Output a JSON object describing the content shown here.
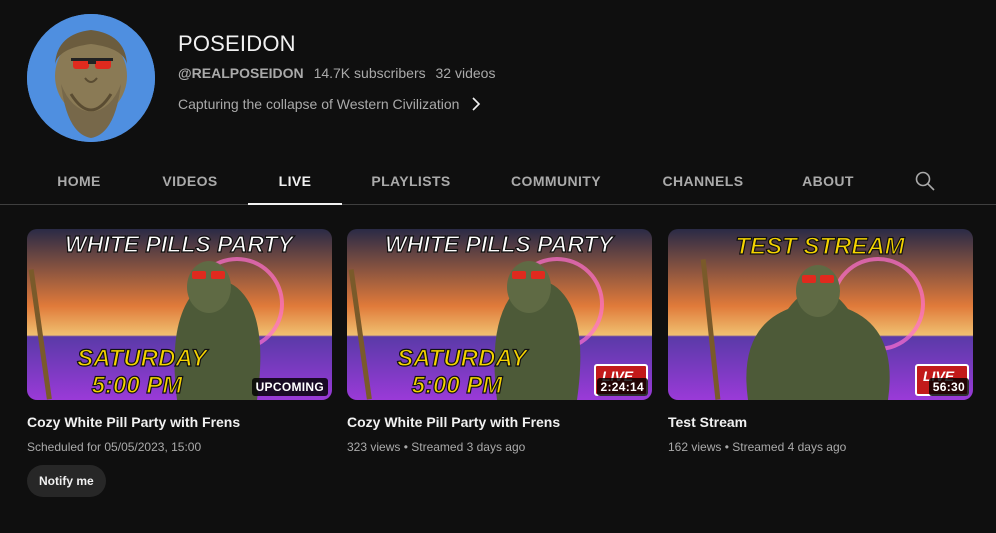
{
  "channel": {
    "name": "POSEIDON",
    "handle": "@REALPOSEIDON",
    "subscribers": "14.7K subscribers",
    "videos": "32 videos",
    "description": "Capturing the collapse of Western Civilization"
  },
  "tabs": [
    {
      "label": "HOME"
    },
    {
      "label": "VIDEOS"
    },
    {
      "label": "LIVE"
    },
    {
      "label": "PLAYLISTS"
    },
    {
      "label": "COMMUNITY"
    },
    {
      "label": "CHANNELS"
    },
    {
      "label": "ABOUT"
    }
  ],
  "active_tab": "LIVE",
  "videos": [
    {
      "thumb_title": "WHITE PILLS PARTY",
      "thumb_line1": "SATURDAY",
      "thumb_line2": "5:00 PM",
      "badge": "UPCOMING",
      "title": "Cozy White Pill Party with Frens",
      "meta": "Scheduled for 05/05/2023, 15:00",
      "action": "Notify me"
    },
    {
      "thumb_title": "WHITE PILLS PARTY",
      "thumb_line1": "SATURDAY",
      "thumb_line2": "5:00 PM",
      "live_label": "LIVE",
      "badge": "2:24:14",
      "title": "Cozy White Pill Party with Frens",
      "meta": "323 views • Streamed 3 days ago"
    },
    {
      "thumb_title": "TEST STREAM",
      "live_label": "LIVE",
      "badge": "56:30",
      "title": "Test Stream",
      "meta": "162 views • Streamed 4 days ago"
    }
  ],
  "colors": {
    "background": "#0f0f0f",
    "text_primary": "#f1f1f1",
    "text_secondary": "#aaaaaa",
    "thumb_text_yellow": "#f5d400",
    "live_red": "#c21a1a"
  }
}
